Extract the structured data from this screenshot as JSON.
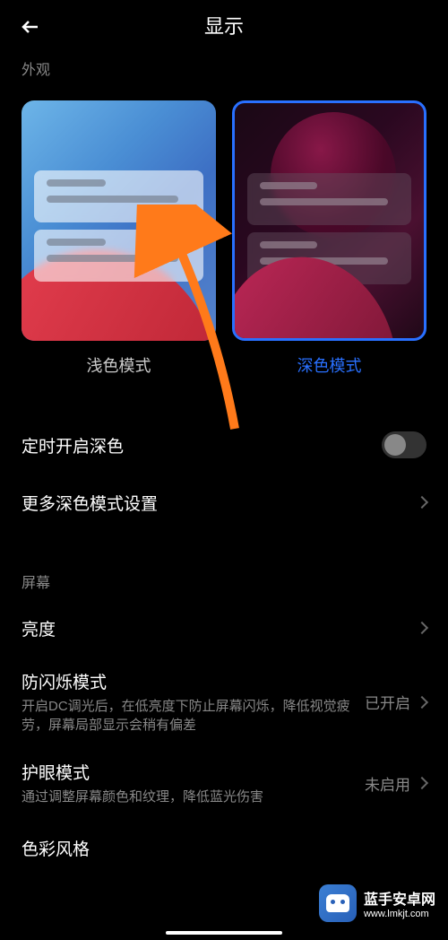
{
  "header": {
    "title": "显示"
  },
  "appearance": {
    "label": "外观",
    "light_label": "浅色模式",
    "dark_label": "深色模式",
    "selected": "dark"
  },
  "settings": {
    "scheduled_dark": "定时开启深色",
    "more_dark": "更多深色模式设置"
  },
  "screen": {
    "label": "屏幕",
    "brightness": "亮度",
    "anti_flicker": {
      "title": "防闪烁模式",
      "desc": "开启DC调光后，在低亮度下防止屏幕闪烁，降低视觉疲劳，屏幕局部显示会稍有偏差",
      "value": "已开启"
    },
    "eye_care": {
      "title": "护眼模式",
      "desc": "通过调整屏幕颜色和纹理，降低蓝光伤害",
      "value": "未启用"
    },
    "color_style": "色彩风格"
  },
  "watermark": {
    "title": "蓝手安卓网",
    "url": "www.lmkjt.com"
  }
}
